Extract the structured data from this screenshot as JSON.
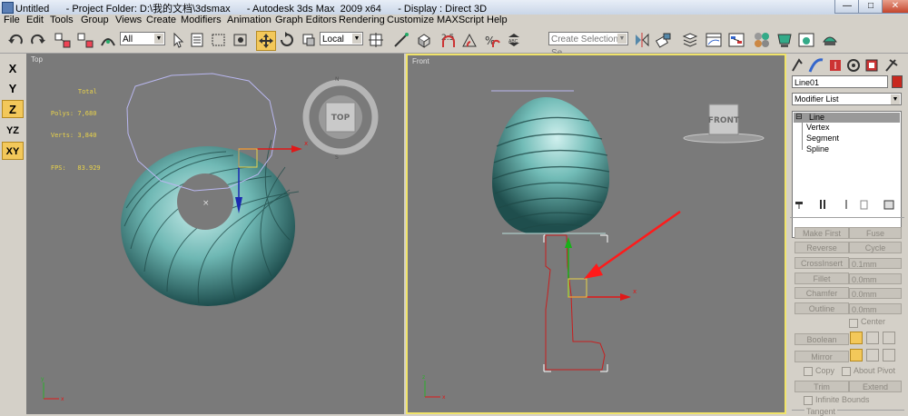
{
  "window": {
    "title": "Untitled      - Project Folder: D:\\我的文档\\3dsmax      - Autodesk 3ds Max  2009 x64      - Display : Direct 3D",
    "minimize": "—",
    "maximize": "□",
    "close": "✕"
  },
  "menu": [
    "File",
    "Edit",
    "Tools",
    "Group",
    "Views",
    "Create",
    "Modifiers",
    "Animation",
    "Graph Editors",
    "Rendering",
    "Customize",
    "MAXScript",
    "Help"
  ],
  "toolbar": {
    "selection_filter": "All",
    "coord_system": "Local",
    "named_selection_placeholder": "Create Selection Se"
  },
  "axis_buttons": [
    "X",
    "Y",
    "Z",
    "YZ",
    "XY"
  ],
  "viewports": {
    "top": {
      "label": "Top",
      "stats": {
        "total_label": "Total",
        "polys": "Polys: 7,680",
        "verts": "Verts: 3,840",
        "fps": "FPS:   83.929"
      },
      "viewcube_label": "TOP"
    },
    "front": {
      "label": "Front",
      "viewcube_label": "FRONT"
    }
  },
  "command_panel": {
    "object_name": "Line01",
    "object_color": "#c8281e",
    "modifier_list_label": "Modifier List",
    "stack": [
      "Line",
      "Vertex",
      "Segment",
      "Spline"
    ],
    "buttons": {
      "make_first": "Make First",
      "fuse": "Fuse",
      "reverse": "Reverse",
      "cycle": "Cycle",
      "crossinsert": "CrossInsert",
      "fillet": "Fillet",
      "chamfer": "Chamfer",
      "outline": "Outline",
      "boolean": "Boolean",
      "mirror": "Mirror",
      "trim": "Trim",
      "extend": "Extend"
    },
    "spinners": {
      "crossinsert": "0.1mm",
      "fillet": "0.0mm",
      "chamfer": "0.0mm",
      "outline": "0.0mm"
    },
    "checks": {
      "center": "Center",
      "copy": "Copy",
      "about_pivot": "About Pivot",
      "infinite_bounds": "Infinite Bounds",
      "tangent": "Tangent"
    }
  }
}
